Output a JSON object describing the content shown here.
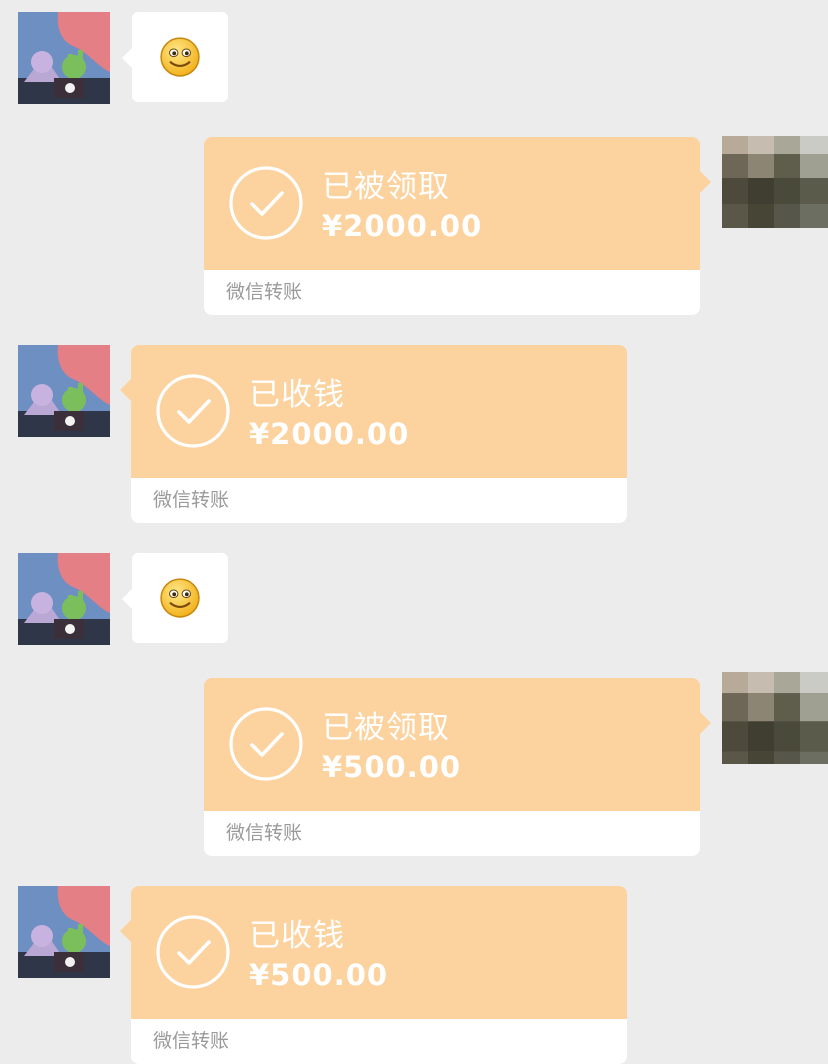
{
  "conversation": {
    "messages": [
      {
        "type": "emoji",
        "side": "left",
        "emoji": "smile-face"
      },
      {
        "type": "transfer",
        "side": "right",
        "status": "已被领取",
        "amount": "¥2000.00",
        "source": "微信转账"
      },
      {
        "type": "transfer",
        "side": "left",
        "status": "已收钱",
        "amount": "¥2000.00",
        "source": "微信转账"
      },
      {
        "type": "emoji",
        "side": "left",
        "emoji": "smile-face"
      },
      {
        "type": "transfer",
        "side": "right",
        "status": "已被领取",
        "amount": "¥500.00",
        "source": "微信转账"
      },
      {
        "type": "transfer",
        "side": "left",
        "status": "已收钱",
        "amount": "¥500.00",
        "source": "微信转账"
      }
    ]
  },
  "colors": {
    "background": "#ececec",
    "transfer_card": "#fcd29e",
    "bubble": "#ffffff",
    "source_text": "#9a9a9a"
  },
  "icons": {
    "transfer_status": "check-circle-icon",
    "emoji": "smile-face"
  }
}
